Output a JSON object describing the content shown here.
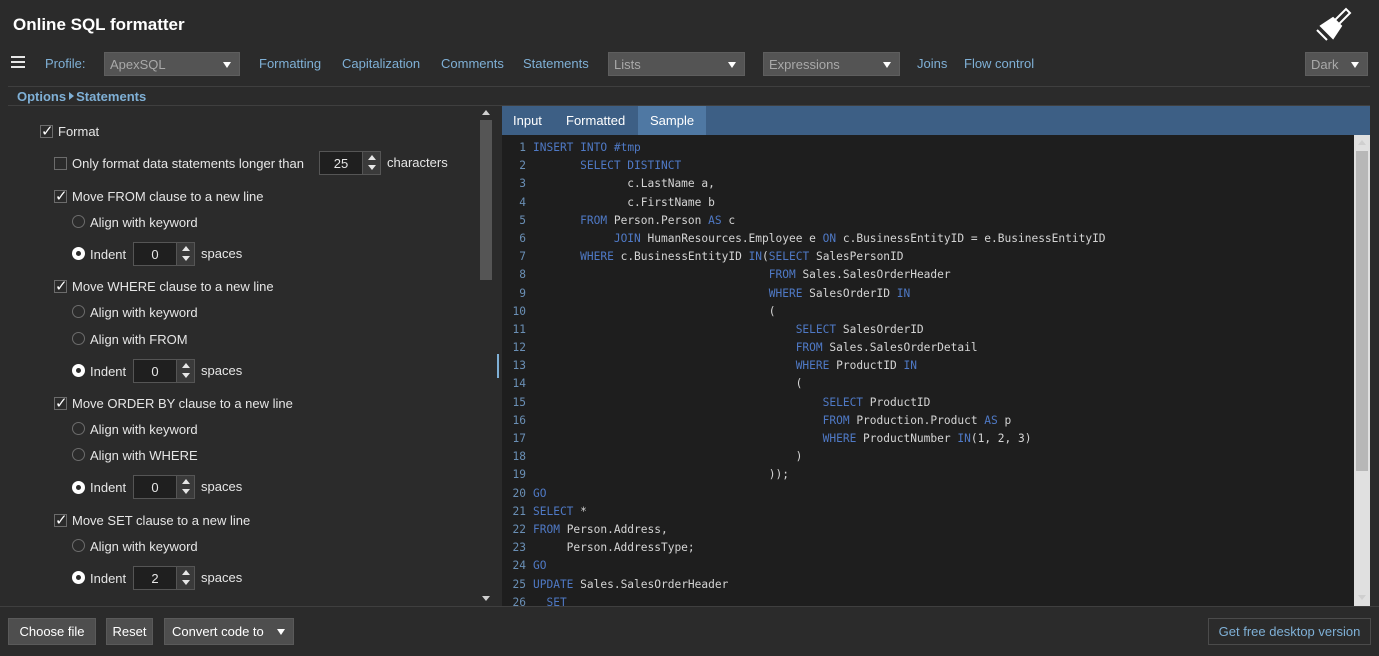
{
  "app": {
    "title": "Online SQL formatter"
  },
  "menubar": {
    "profile_label": "Profile:",
    "profile_value": "ApexSQL",
    "items": [
      "Formatting",
      "Capitalization",
      "Comments",
      "Statements"
    ],
    "lists_dropdown": "Lists",
    "expressions_dropdown": "Expressions",
    "items2": [
      "Joins",
      "Flow control"
    ],
    "theme_dropdown": "Dark"
  },
  "breadcrumb": {
    "root": "Options",
    "current": "Statements"
  },
  "options": {
    "format": "Format",
    "only_format": "Only format data statements longer than",
    "only_format_value": "25",
    "characters": "characters",
    "move_from": "Move FROM clause to a new line",
    "move_where": "Move WHERE clause to a new line",
    "move_order_by": "Move ORDER BY clause to a new line",
    "move_set": "Move SET clause to a new line",
    "align_keyword": "Align with keyword",
    "align_from": "Align with FROM",
    "align_where": "Align with WHERE",
    "indent": "Indent",
    "spaces": "spaces",
    "from_indent": "0",
    "where_indent": "0",
    "order_indent": "0",
    "set_indent": "2"
  },
  "editor": {
    "tabs": [
      "Input",
      "Formatted",
      "Sample"
    ],
    "active_tab": "Sample",
    "lines": [
      {
        "n": "1",
        "t": [
          [
            "kw",
            "INSERT INTO"
          ],
          [
            "id",
            " "
          ],
          [
            "kw",
            "#tmp"
          ]
        ]
      },
      {
        "n": "2",
        "t": [
          [
            "id",
            "       "
          ],
          [
            "kw",
            "SELECT DISTINCT"
          ]
        ]
      },
      {
        "n": "3",
        "t": [
          [
            "id",
            "              c.LastName a,"
          ]
        ]
      },
      {
        "n": "4",
        "t": [
          [
            "id",
            "              c.FirstName b"
          ]
        ]
      },
      {
        "n": "5",
        "t": [
          [
            "id",
            "       "
          ],
          [
            "kw",
            "FROM"
          ],
          [
            "id",
            " Person.Person "
          ],
          [
            "kw",
            "AS"
          ],
          [
            "id",
            " c"
          ]
        ]
      },
      {
        "n": "6",
        "t": [
          [
            "id",
            "            "
          ],
          [
            "kw",
            "JOIN"
          ],
          [
            "id",
            " HumanResources.Employee e "
          ],
          [
            "kw",
            "ON"
          ],
          [
            "id",
            " c.BusinessEntityID = e.BusinessEntityID"
          ]
        ]
      },
      {
        "n": "7",
        "t": [
          [
            "id",
            "       "
          ],
          [
            "kw",
            "WHERE"
          ],
          [
            "id",
            " c.BusinessEntityID "
          ],
          [
            "kw",
            "IN"
          ],
          [
            "id",
            "("
          ],
          [
            "kw",
            "SELECT"
          ],
          [
            "id",
            " SalesPersonID"
          ]
        ]
      },
      {
        "n": "8",
        "t": [
          [
            "id",
            "                                   "
          ],
          [
            "kw",
            "FROM"
          ],
          [
            "id",
            " Sales.SalesOrderHeader"
          ]
        ]
      },
      {
        "n": "9",
        "t": [
          [
            "id",
            "                                   "
          ],
          [
            "kw",
            "WHERE"
          ],
          [
            "id",
            " SalesOrderID "
          ],
          [
            "kw",
            "IN"
          ]
        ]
      },
      {
        "n": "10",
        "t": [
          [
            "id",
            "                                   ("
          ]
        ]
      },
      {
        "n": "11",
        "t": [
          [
            "id",
            "                                       "
          ],
          [
            "kw",
            "SELECT"
          ],
          [
            "id",
            " SalesOrderID"
          ]
        ]
      },
      {
        "n": "12",
        "t": [
          [
            "id",
            "                                       "
          ],
          [
            "kw",
            "FROM"
          ],
          [
            "id",
            " Sales.SalesOrderDetail"
          ]
        ]
      },
      {
        "n": "13",
        "t": [
          [
            "id",
            "                                       "
          ],
          [
            "kw",
            "WHERE"
          ],
          [
            "id",
            " ProductID "
          ],
          [
            "kw",
            "IN"
          ]
        ]
      },
      {
        "n": "14",
        "t": [
          [
            "id",
            "                                       ("
          ]
        ]
      },
      {
        "n": "15",
        "t": [
          [
            "id",
            "                                           "
          ],
          [
            "kw",
            "SELECT"
          ],
          [
            "id",
            " ProductID"
          ]
        ]
      },
      {
        "n": "16",
        "t": [
          [
            "id",
            "                                           "
          ],
          [
            "kw",
            "FROM"
          ],
          [
            "id",
            " Production.Product "
          ],
          [
            "kw",
            "AS"
          ],
          [
            "id",
            " p"
          ]
        ]
      },
      {
        "n": "17",
        "t": [
          [
            "id",
            "                                           "
          ],
          [
            "kw",
            "WHERE"
          ],
          [
            "id",
            " ProductNumber "
          ],
          [
            "kw",
            "IN"
          ],
          [
            "id",
            "(1, 2, 3)"
          ]
        ]
      },
      {
        "n": "18",
        "t": [
          [
            "id",
            "                                       )"
          ]
        ]
      },
      {
        "n": "19",
        "t": [
          [
            "id",
            "                                   ));"
          ]
        ]
      },
      {
        "n": "20",
        "t": [
          [
            "kw",
            "GO"
          ]
        ]
      },
      {
        "n": "21",
        "t": [
          [
            "kw",
            "SELECT"
          ],
          [
            "id",
            " *"
          ]
        ]
      },
      {
        "n": "22",
        "t": [
          [
            "kw",
            "FROM"
          ],
          [
            "id",
            " Person.Address,"
          ]
        ]
      },
      {
        "n": "23",
        "t": [
          [
            "id",
            "     Person.AddressType;"
          ]
        ]
      },
      {
        "n": "24",
        "t": [
          [
            "kw",
            "GO"
          ]
        ]
      },
      {
        "n": "25",
        "t": [
          [
            "kw",
            "UPDATE"
          ],
          [
            "id",
            " Sales.SalesOrderHeader"
          ]
        ]
      },
      {
        "n": "26",
        "t": [
          [
            "id",
            "  "
          ],
          [
            "kw",
            "SET"
          ]
        ]
      }
    ]
  },
  "bottombar": {
    "choose_file": "Choose file",
    "reset": "Reset",
    "convert": "Convert code to",
    "desktop": "Get free desktop version"
  },
  "colors": {
    "accent": "#7fb0d6",
    "tabbar": "#3d5f85",
    "keyword": "#4f79c5"
  }
}
